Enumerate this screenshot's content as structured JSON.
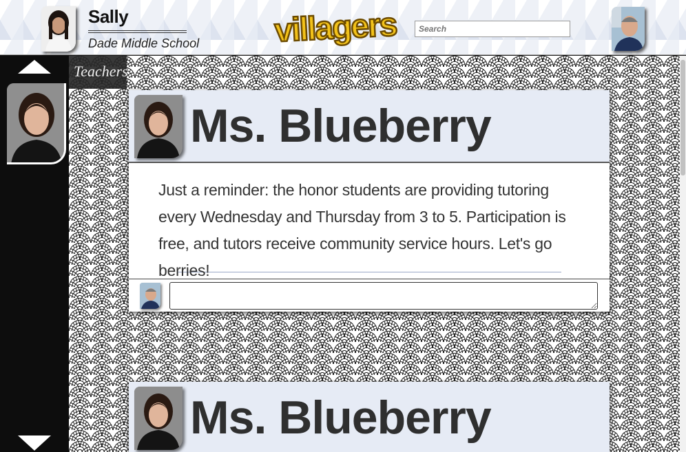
{
  "header": {
    "user_name": "Sally",
    "user_school": "Dade Middle School",
    "logo_text": "villagers",
    "search_placeholder": "Search"
  },
  "sidebar": {
    "section_label": "Teachers"
  },
  "posts": [
    {
      "author": "Ms. Blueberry",
      "body": "Just a reminder: the honor students are providing tutoring every Wednesday and Thursday from 3 to 5. Participation is free, and tutors receive community service hours. Let's go berries!",
      "comment_placeholder": ""
    },
    {
      "author": "Ms. Blueberry"
    }
  ],
  "colors": {
    "logo_fill": "#f2c21a",
    "logo_stroke": "#6b4a00",
    "card_header_bg": "#e6ebf5",
    "sidebar_bg": "#0d0d0d"
  }
}
